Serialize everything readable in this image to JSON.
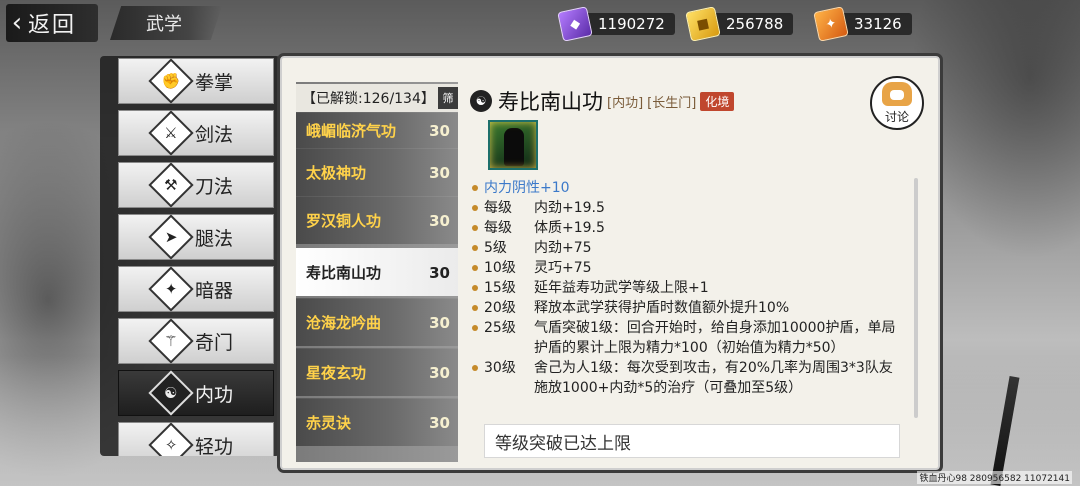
{
  "header": {
    "back_label": "返回",
    "title": "武学"
  },
  "currencies": [
    {
      "icon": "purple-gem-icon",
      "value": "1190272",
      "color": "#8f55e0"
    },
    {
      "icon": "gold-token-icon",
      "value": "256788",
      "color": "#e2b01f"
    },
    {
      "icon": "orange-token-icon",
      "value": "33126",
      "color": "#e47721"
    }
  ],
  "categories": [
    {
      "label": "拳掌",
      "icon": "fist-icon"
    },
    {
      "label": "剑法",
      "icon": "sword-icon"
    },
    {
      "label": "刀法",
      "icon": "blade-icon"
    },
    {
      "label": "腿法",
      "icon": "kick-icon"
    },
    {
      "label": "暗器",
      "icon": "shuriken-icon"
    },
    {
      "label": "奇门",
      "icon": "odd-weapon-icon"
    },
    {
      "label": "内功",
      "icon": "inner-power-icon",
      "active": true
    },
    {
      "label": "轻功",
      "icon": "light-body-icon"
    }
  ],
  "skill_list": {
    "unlock_text": "【已解锁:126/134】",
    "filter_label": "筛",
    "items": [
      {
        "name": "峨嵋临济气功",
        "level": "30"
      },
      {
        "name": "太极神功",
        "level": "30"
      },
      {
        "name": "罗汉铜人功",
        "level": "30"
      },
      {
        "name": "寿比南山功",
        "level": "30",
        "selected": true
      },
      {
        "name": "沧海龙吟曲",
        "level": "30"
      },
      {
        "name": "星夜玄功",
        "level": "30"
      },
      {
        "name": "赤灵诀",
        "level": "30"
      }
    ]
  },
  "detail": {
    "name": "寿比南山功",
    "type_tag": "[内功]",
    "sect_tag": "[长生门]",
    "realm_badge": "化境",
    "attributes": [
      {
        "level": "",
        "text": "内力阴性+10",
        "highlight": true
      },
      {
        "level": "每级",
        "text": "内劲+19.5"
      },
      {
        "level": "每级",
        "text": "体质+19.5"
      },
      {
        "level": "5级",
        "text": "内劲+75"
      },
      {
        "level": "10级",
        "text": "灵巧+75"
      },
      {
        "level": "15级",
        "text": "延年益寿功武学等级上限+1"
      },
      {
        "level": "20级",
        "text": "释放本武学获得护盾时数值额外提升10%"
      },
      {
        "level": "25级",
        "text": "气盾突破1级：回合开始时，给自身添加10000护盾，单局护盾的累计上限为精力*100（初始值为精力*50）"
      },
      {
        "level": "30级",
        "text": "舍己为人1级：每次受到攻击，有20%几率为周围3*3队友施放1000+内劲*5的治疗（可叠加至5级）"
      }
    ],
    "limit_text": "等级突破已达上限"
  },
  "discuss": {
    "label": "讨论"
  },
  "watermark": "铁血丹心98 280956582 11072141"
}
